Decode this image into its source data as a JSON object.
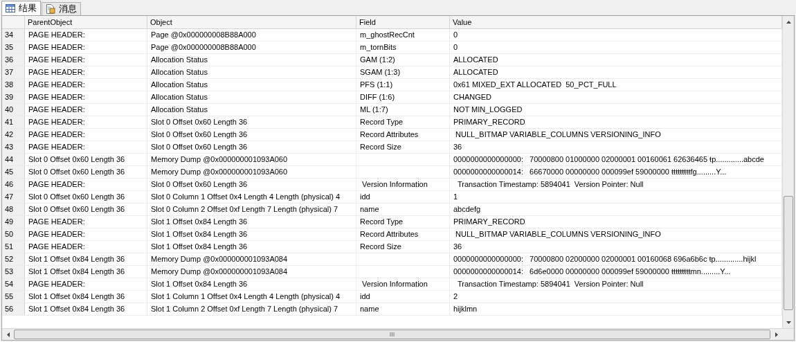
{
  "tabs": [
    {
      "label": "结果",
      "kind": "grid",
      "selected": true
    },
    {
      "label": "消息",
      "kind": "messages",
      "selected": false
    }
  ],
  "table": {
    "columns": [
      "ParentObject",
      "Object",
      "Field",
      "Value"
    ],
    "rows": [
      {
        "number": "34",
        "parent_object": "PAGE HEADER:",
        "object": "Page @0x000000008B88A000",
        "field": "m_ghostRecCnt",
        "value": "0"
      },
      {
        "number": "35",
        "parent_object": "PAGE HEADER:",
        "object": "Page @0x000000008B88A000",
        "field": "m_tornBits",
        "value": "0"
      },
      {
        "number": "36",
        "parent_object": "PAGE HEADER:",
        "object": "Allocation Status",
        "field": "GAM (1:2)",
        "value": "ALLOCATED"
      },
      {
        "number": "37",
        "parent_object": "PAGE HEADER:",
        "object": "Allocation Status",
        "field": "SGAM (1:3)",
        "value": "ALLOCATED"
      },
      {
        "number": "38",
        "parent_object": "PAGE HEADER:",
        "object": "Allocation Status",
        "field": "PFS (1:1)",
        "value": "0x61 MIXED_EXT ALLOCATED  50_PCT_FULL"
      },
      {
        "number": "39",
        "parent_object": "PAGE HEADER:",
        "object": "Allocation Status",
        "field": "DIFF (1:6)",
        "value": "CHANGED"
      },
      {
        "number": "40",
        "parent_object": "PAGE HEADER:",
        "object": "Allocation Status",
        "field": "ML (1:7)",
        "value": "NOT MIN_LOGGED"
      },
      {
        "number": "41",
        "parent_object": "PAGE HEADER:",
        "object": "Slot 0 Offset 0x60 Length 36",
        "field": "Record Type",
        "value": "PRIMARY_RECORD"
      },
      {
        "number": "42",
        "parent_object": "PAGE HEADER:",
        "object": "Slot 0 Offset 0x60 Length 36",
        "field": "Record Attributes",
        "value": " NULL_BITMAP VARIABLE_COLUMNS VERSIONING_INFO"
      },
      {
        "number": "43",
        "parent_object": "PAGE HEADER:",
        "object": "Slot 0 Offset 0x60 Length 36",
        "field": "Record Size",
        "value": "36"
      },
      {
        "number": "44",
        "parent_object": "Slot 0 Offset 0x60 Length 36",
        "object": "Memory Dump @0x000000001093A060",
        "value": "0000000000000000:   70000800 01000000 02000001 00160061 62636465 ŧp.............abcde"
      },
      {
        "number": "45",
        "parent_object": "Slot 0 Offset 0x60 Length 36",
        "object": "Memory Dump @0x000000001093A060",
        "value": "0000000000000014:   66670000 00000000 000099ef 59000000 ŧŧŧŧŧŧŧŧŧfg.........Y..."
      },
      {
        "number": "46",
        "parent_object": "PAGE HEADER:",
        "object": "Slot 0 Offset 0x60 Length 36",
        "field": " Version Information",
        "value": "  Transaction Timestamp: 5894041  Version Pointer: Null"
      },
      {
        "number": "47",
        "parent_object": "Slot 0 Offset 0x60 Length 36",
        "object": "Slot 0 Column 1 Offset 0x4 Length 4 Length (physical) 4",
        "field": "idd",
        "value": "1"
      },
      {
        "number": "48",
        "parent_object": "Slot 0 Offset 0x60 Length 36",
        "object": "Slot 0 Column 2 Offset 0xf Length 7 Length (physical) 7",
        "field": "name",
        "value": "abcdefg"
      },
      {
        "number": "49",
        "parent_object": "PAGE HEADER:",
        "object": "Slot 1 Offset 0x84 Length 36",
        "field": "Record Type",
        "value": "PRIMARY_RECORD"
      },
      {
        "number": "50",
        "parent_object": "PAGE HEADER:",
        "object": "Slot 1 Offset 0x84 Length 36",
        "field": "Record Attributes",
        "value": " NULL_BITMAP VARIABLE_COLUMNS VERSIONING_INFO"
      },
      {
        "number": "51",
        "parent_object": "PAGE HEADER:",
        "object": "Slot 1 Offset 0x84 Length 36",
        "field": "Record Size",
        "value": "36"
      },
      {
        "number": "52",
        "parent_object": "Slot 1 Offset 0x84 Length 36",
        "object": "Memory Dump @0x000000001093A084",
        "value": "0000000000000000:   70000800 02000000 02000001 00160068 696a6b6c ŧp.............hijkl"
      },
      {
        "number": "53",
        "parent_object": "Slot 1 Offset 0x84 Length 36",
        "object": "Memory Dump @0x000000001093A084",
        "value": "0000000000000014:   6d6e0000 00000000 000099ef 59000000 ŧŧŧŧŧŧŧŧŧmn.........Y..."
      },
      {
        "number": "54",
        "parent_object": "PAGE HEADER:",
        "object": "Slot 1 Offset 0x84 Length 36",
        "field": " Version Information",
        "value": "  Transaction Timestamp: 5894041  Version Pointer: Null"
      },
      {
        "number": "55",
        "parent_object": "Slot 1 Offset 0x84 Length 36",
        "object": "Slot 1 Column 1 Offset 0x4 Length 4 Length (physical) 4",
        "field": "idd",
        "value": "2"
      },
      {
        "number": "56",
        "parent_object": "Slot 1 Offset 0x84 Length 36",
        "object": "Slot 1 Column 2 Offset 0xf Length 7 Length (physical) 7",
        "field": "name",
        "value": "hijklmn"
      }
    ]
  }
}
